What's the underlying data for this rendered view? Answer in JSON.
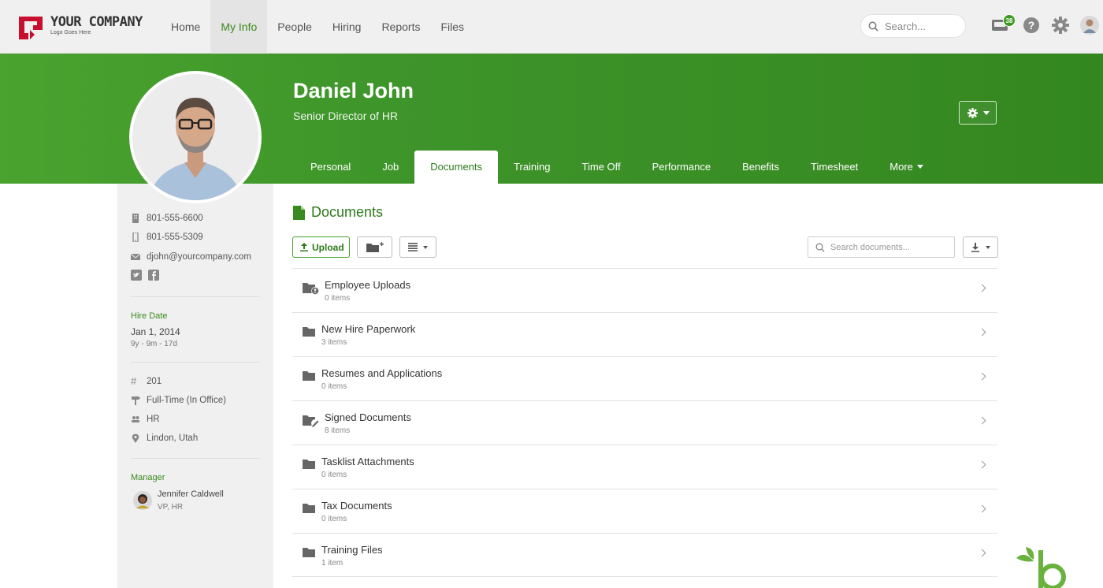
{
  "brand": {
    "name": "YOUR COMPANY",
    "tagline": "Logo Goes Here"
  },
  "nav": {
    "items": [
      "Home",
      "My Info",
      "People",
      "Hiring",
      "Reports",
      "Files"
    ],
    "active": "My Info"
  },
  "search": {
    "placeholder": "Search..."
  },
  "notifications": {
    "count": "38"
  },
  "profile": {
    "name": "Daniel John",
    "title": "Senior Director of HR"
  },
  "tabs": {
    "items": [
      "Personal",
      "Job",
      "Documents",
      "Training",
      "Time Off",
      "Performance",
      "Benefits",
      "Timesheet",
      "More"
    ],
    "active": "Documents"
  },
  "sidebar": {
    "work_phone": "801-555-6600",
    "mobile_phone": "801-555-5309",
    "email": "djohn@yourcompany.com",
    "hire_date_label": "Hire Date",
    "hire_date": "Jan 1, 2014",
    "tenure": "9y - 9m - 17d",
    "employee_number": "201",
    "employment_status": "Full-Time (In Office)",
    "department": "HR",
    "location": "Lindon, Utah",
    "manager_label": "Manager",
    "manager_name": "Jennifer Caldwell",
    "manager_title": "VP, HR"
  },
  "documents": {
    "heading": "Documents",
    "upload_label": "Upload",
    "search_placeholder": "Search documents...",
    "folders": [
      {
        "name": "Employee Uploads",
        "count": "0 items",
        "icon": "folder-user-icon"
      },
      {
        "name": "New Hire Paperwork",
        "count": "3 items",
        "icon": "folder-icon"
      },
      {
        "name": "Resumes and Applications",
        "count": "0 items",
        "icon": "folder-icon"
      },
      {
        "name": "Signed Documents",
        "count": "8 items",
        "icon": "folder-signed-icon"
      },
      {
        "name": "Tasklist Attachments",
        "count": "0 items",
        "icon": "folder-icon"
      },
      {
        "name": "Tax Documents",
        "count": "0 items",
        "icon": "folder-icon"
      },
      {
        "name": "Training Files",
        "count": "1 item",
        "icon": "folder-icon"
      }
    ]
  },
  "colors": {
    "brand_green": "#3e952a",
    "accent_green": "#2d7a19",
    "logo_red": "#c8102e"
  }
}
